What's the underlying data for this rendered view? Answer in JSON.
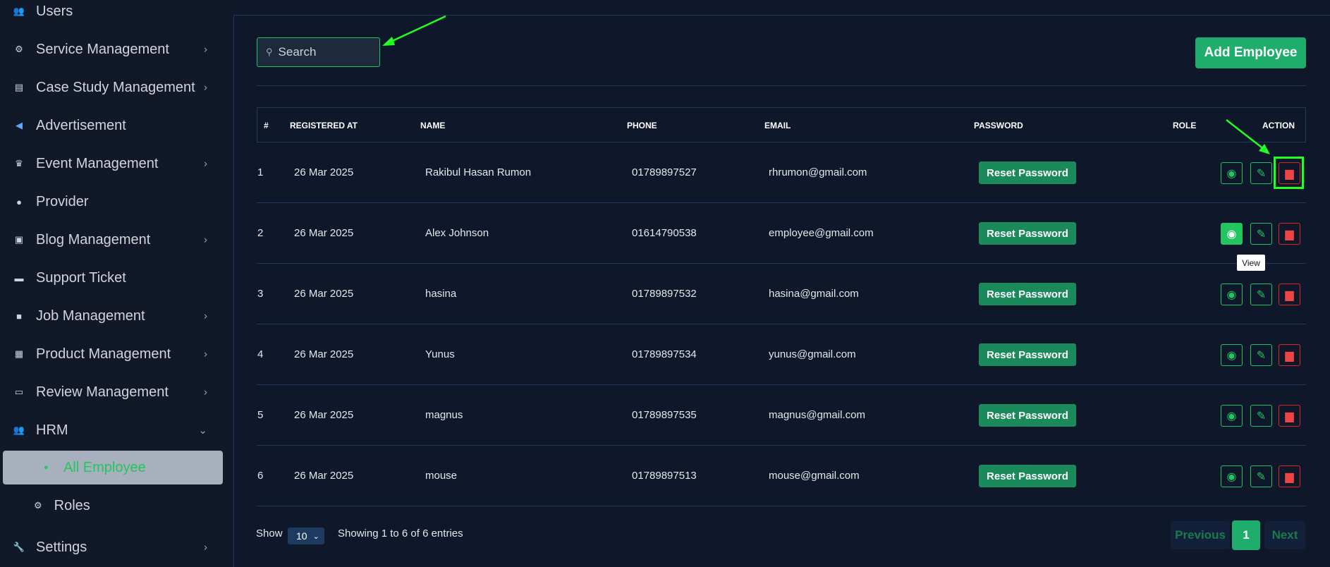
{
  "sidebar": {
    "items": [
      {
        "label": "Users",
        "icon": "users-icon",
        "chevron": false
      },
      {
        "label": "Service Management",
        "icon": "services-icon",
        "chevron": true
      },
      {
        "label": "Case Study Management",
        "icon": "document-icon",
        "chevron": true
      },
      {
        "label": "Advertisement",
        "icon": "megaphone-icon",
        "chevron": false
      },
      {
        "label": "Event Management",
        "icon": "trophy-icon",
        "chevron": true
      },
      {
        "label": "Provider",
        "icon": "user-icon",
        "chevron": false
      },
      {
        "label": "Blog Management",
        "icon": "blog-icon",
        "chevron": true
      },
      {
        "label": "Support Ticket",
        "icon": "ticket-icon",
        "chevron": false
      },
      {
        "label": "Job Management",
        "icon": "briefcase-icon",
        "chevron": true
      },
      {
        "label": "Product Management",
        "icon": "grid-icon",
        "chevron": true
      },
      {
        "label": "Review Management",
        "icon": "review-icon",
        "chevron": true
      },
      {
        "label": "HRM",
        "icon": "team-icon",
        "chevron": true
      }
    ],
    "sub_items": {
      "all_employee": "All Employee",
      "roles": "Roles"
    },
    "settings": "Settings"
  },
  "search": {
    "placeholder": "Search",
    "value": ""
  },
  "add_button": "Add Employee",
  "table": {
    "headers": {
      "index": "#",
      "registered": "REGISTERED AT",
      "name": "NAME",
      "phone": "PHONE",
      "email": "EMAIL",
      "password": "PASSWORD",
      "role": "ROLE",
      "action": "ACTION"
    },
    "rows": [
      {
        "index": "1",
        "registered": "26 Mar 2025",
        "name": "Rakibul Hasan Rumon",
        "phone": "01789897527",
        "email": "rhrumon@gmail.com",
        "password_button": "Reset Password"
      },
      {
        "index": "2",
        "registered": "26 Mar 2025",
        "name": "Alex Johnson",
        "phone": "01614790538",
        "email": "employee@gmail.com",
        "password_button": "Reset Password"
      },
      {
        "index": "3",
        "registered": "26 Mar 2025",
        "name": "hasina",
        "phone": "01789897532",
        "email": "hasina@gmail.com",
        "password_button": "Reset Password"
      },
      {
        "index": "4",
        "registered": "26 Mar 2025",
        "name": "Yunus",
        "phone": "01789897534",
        "email": "yunus@gmail.com",
        "password_button": "Reset Password"
      },
      {
        "index": "5",
        "registered": "26 Mar 2025",
        "name": "magnus",
        "phone": "01789897535",
        "email": "magnus@gmail.com",
        "password_button": "Reset Password"
      },
      {
        "index": "6",
        "registered": "26 Mar 2025",
        "name": "mouse",
        "phone": "01789897513",
        "email": "mouse@gmail.com",
        "password_button": "Reset Password"
      }
    ],
    "tooltip": "View"
  },
  "footer": {
    "show_label": "Show",
    "page_size": "10",
    "info": "Showing 1 to 6 of 6 entries",
    "previous": "Previous",
    "page": "1",
    "next": "Next"
  },
  "colors": {
    "background": "#0f172a",
    "sidebar": "#111827",
    "accent": "#1ead6b",
    "danger": "#dc2626",
    "annotation": "#22ff22"
  }
}
